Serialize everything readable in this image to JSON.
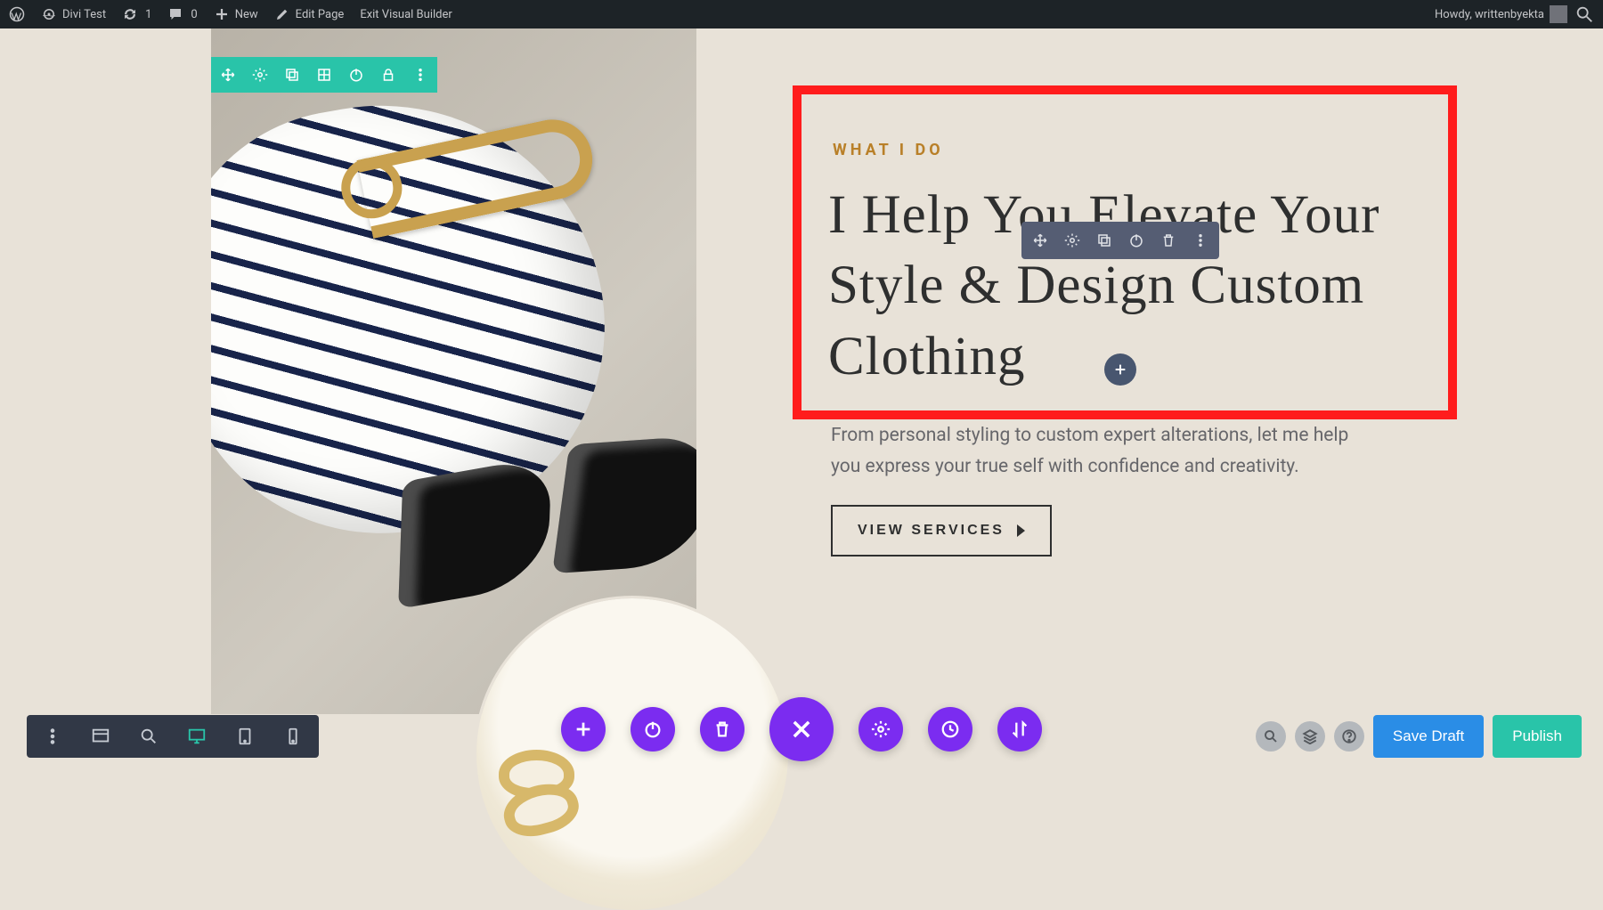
{
  "adminbar": {
    "site_title": "Divi Test",
    "updates_count": "1",
    "comments_count": "0",
    "new_label": "New",
    "edit_page_label": "Edit Page",
    "exit_vb_label": "Exit Visual Builder",
    "howdy": "Howdy, writtenbyekta"
  },
  "content": {
    "eyebrow": "WHAT I DO",
    "headline": "I Help You Elevate Your Style & Design Custom Clothing",
    "body": "From personal styling  to custom expert alterations, let me help you express your true self with confidence and creativity.",
    "cta_label": "VIEW SERVICES"
  },
  "bottom_buttons": {
    "save_draft": "Save Draft",
    "publish": "Publish"
  }
}
